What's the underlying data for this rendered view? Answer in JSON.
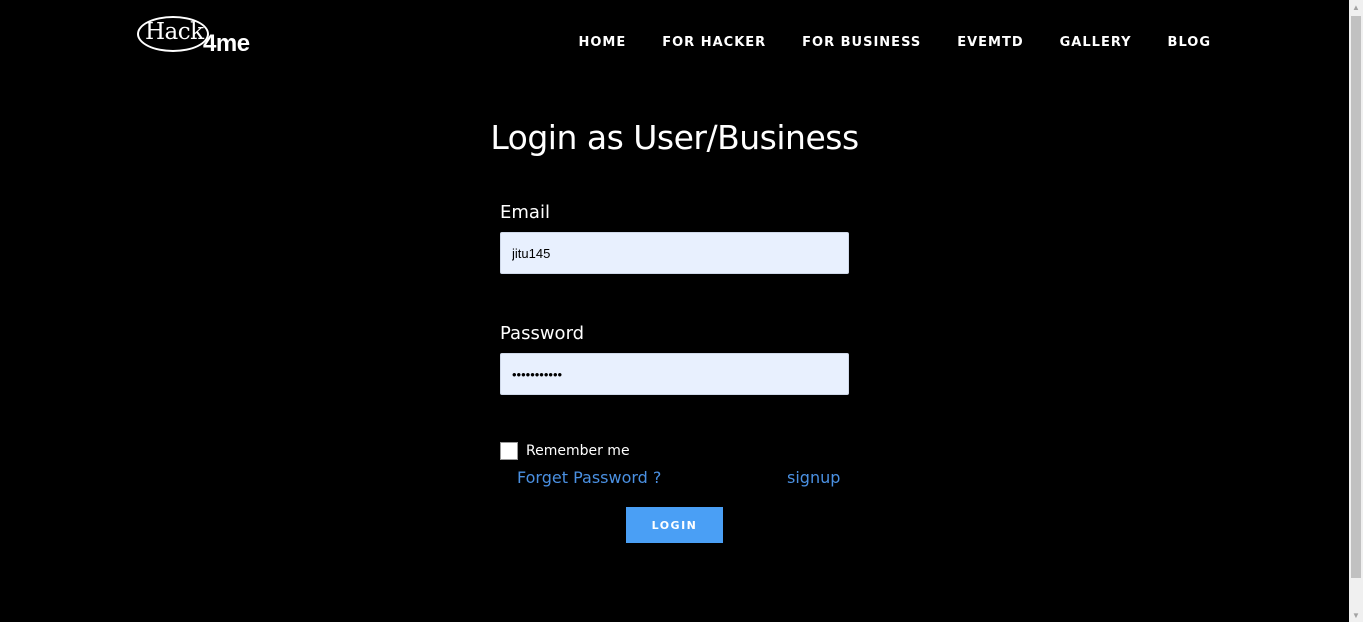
{
  "logo": {
    "part1": "Hack",
    "part2": "4me"
  },
  "nav": {
    "items": [
      {
        "label": "HOME"
      },
      {
        "label": "FOR HACKER"
      },
      {
        "label": "FOR BUSINESS"
      },
      {
        "label": "EVEMTD"
      },
      {
        "label": "GALLERY"
      },
      {
        "label": "BLOG"
      }
    ]
  },
  "form": {
    "title": "Login as User/Business",
    "email_label": "Email",
    "email_value": "jitu145",
    "password_label": "Password",
    "password_value": "•••••••••••",
    "remember_label": "Remember me",
    "remember_checked": false,
    "forget_link": "Forget Password ?",
    "signup_link": "signup",
    "login_button": "LOGIN"
  },
  "colors": {
    "background": "#000000",
    "input_bg": "#e8f0fe",
    "link": "#4a90e2",
    "button": "#4a9ff5"
  }
}
